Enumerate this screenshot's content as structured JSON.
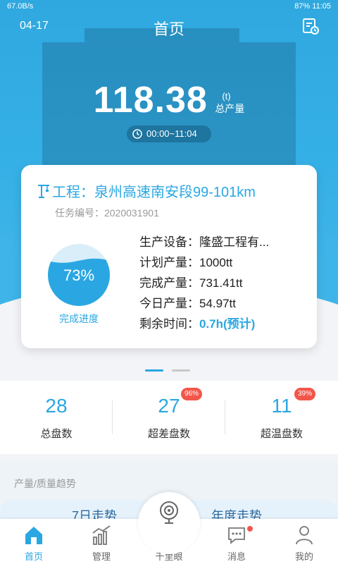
{
  "status": {
    "left": "67.0B/s",
    "battery": "87%",
    "time": "11:05"
  },
  "header": {
    "date": "04-17",
    "title": "首页"
  },
  "summary": {
    "total_output": "118.38",
    "unit": "(t)",
    "label": "总产量",
    "time_range": "00:00~11:04"
  },
  "project": {
    "title": "工程：泉州高速南安段99-101km",
    "task_no": "任务编号：2020031901",
    "progress": 73,
    "progress_text": "73%",
    "progress_label": "完成进度",
    "rows": [
      {
        "label": "生产设备：",
        "value": "隆盛工程有..."
      },
      {
        "label": "计划产量：",
        "value": "1000tt"
      },
      {
        "label": "完成产量：",
        "value": "731.41tt"
      },
      {
        "label": "今日产量：",
        "value": "54.97tt"
      },
      {
        "label": "剩余时间：",
        "value": "0.7h(预计)"
      }
    ]
  },
  "stats": [
    {
      "value": "28",
      "caption": "总盘数",
      "badge": ""
    },
    {
      "value": "27",
      "caption": "超差盘数",
      "badge": "96%"
    },
    {
      "value": "11",
      "caption": "超温盘数",
      "badge": "39%"
    }
  ],
  "trend": {
    "heading": "产量/质量趋势",
    "tab_a": "7日走势",
    "tab_b": "年度走势"
  },
  "tabs": [
    {
      "label": "首页"
    },
    {
      "label": "管理"
    },
    {
      "label": "千里眼"
    },
    {
      "label": "消息"
    },
    {
      "label": "我的"
    }
  ],
  "colors": {
    "primary": "#2aa7e2",
    "badge": "#f2564a"
  }
}
